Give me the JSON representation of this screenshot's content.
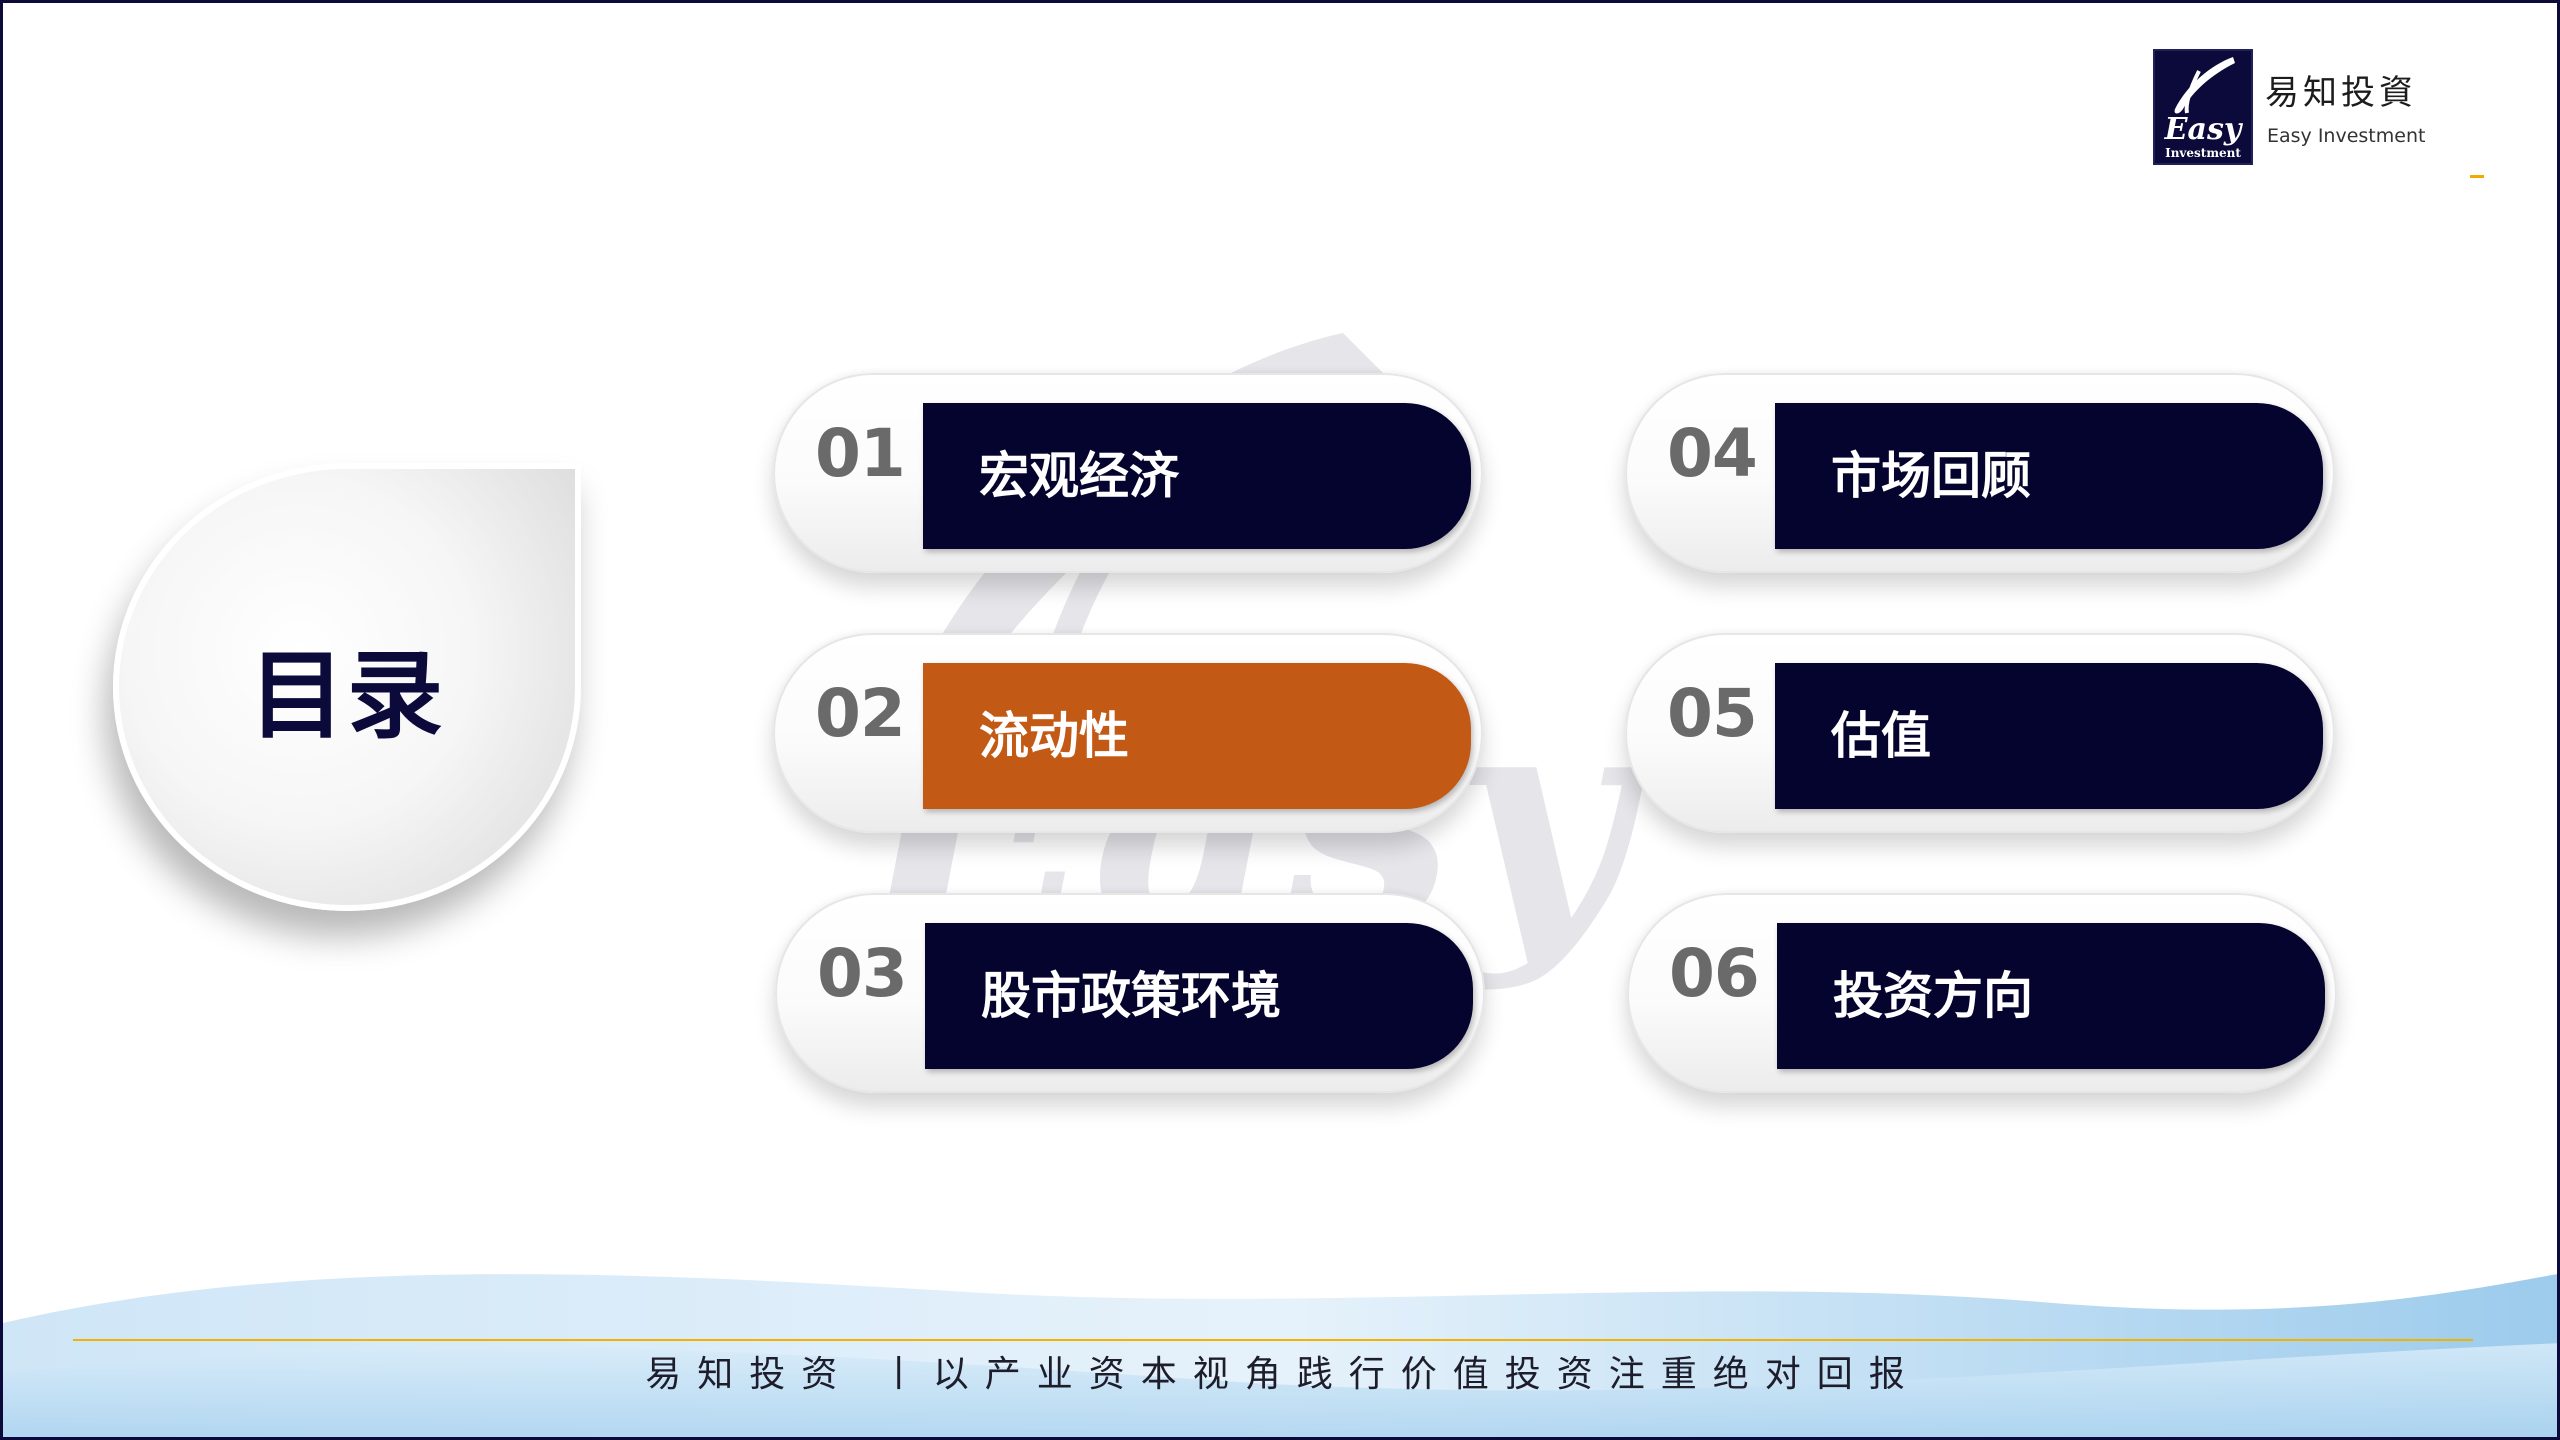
{
  "logo": {
    "cn_name": "易知投資",
    "en_name": "Easy Investment",
    "mark_text": "Easy",
    "mark_subtext": "Investment"
  },
  "title": "目录",
  "menu": [
    {
      "number": "01",
      "label": "宏观经济",
      "active": false
    },
    {
      "number": "02",
      "label": "流动性",
      "active": true
    },
    {
      "number": "03",
      "label": "股市政策环境",
      "active": false
    },
    {
      "number": "04",
      "label": "市场回顾",
      "active": false
    },
    {
      "number": "05",
      "label": "估值",
      "active": false
    },
    {
      "number": "06",
      "label": "投资方向",
      "active": false
    }
  ],
  "footer": {
    "text": "易知投资 丨以产业资本视角践行价值投资注重绝对回报"
  },
  "colors": {
    "navy": "#05042e",
    "active_orange": "#c25914",
    "accent_gold": "#f0b400",
    "number_gray": "#6a6a6a",
    "wave_blue": "#bcdcf3"
  }
}
